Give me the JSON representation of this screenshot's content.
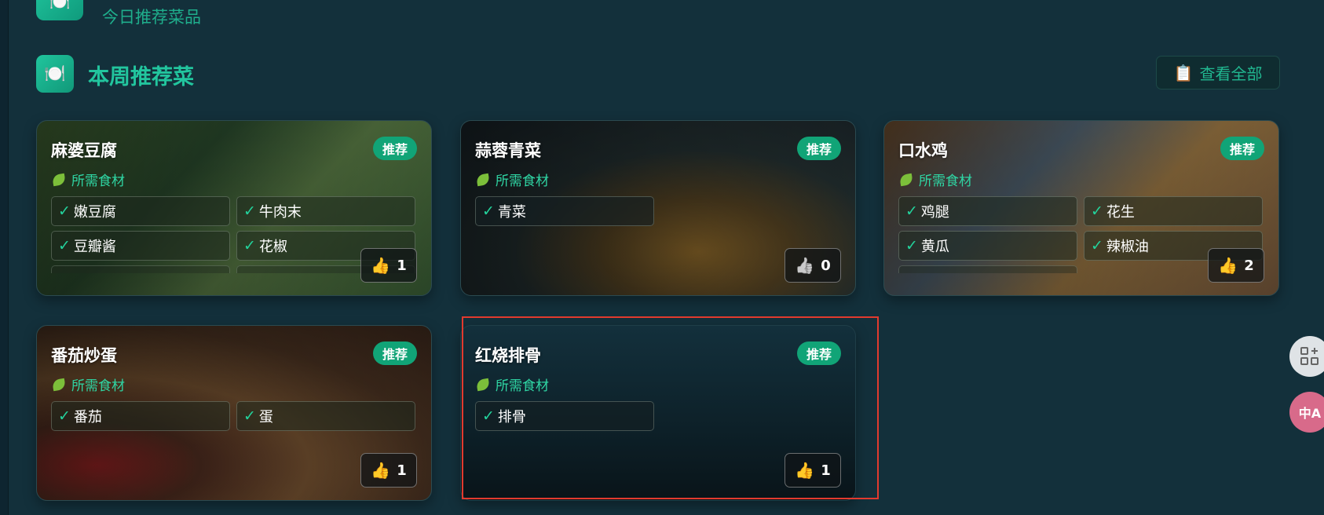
{
  "header": {
    "top_icon": "plate-icon",
    "top_subtitle": "今日推荐菜品",
    "section_icon": "plate-icon",
    "section_title": "本周推荐菜",
    "view_all_icon": "clipboard-icon",
    "view_all_label": "查看全部"
  },
  "badge_label": "推荐",
  "ingredients_label": "所需食材",
  "check_mark": "✓",
  "dishes": [
    {
      "name": "麻婆豆腐",
      "ingredients": [
        "嫩豆腐",
        "牛肉末",
        "豆瓣酱",
        "花椒"
      ],
      "likes": "1",
      "liked": true
    },
    {
      "name": "蒜蓉青菜",
      "ingredients": [
        "青菜"
      ],
      "likes": "0",
      "liked": false
    },
    {
      "name": "口水鸡",
      "ingredients": [
        "鸡腿",
        "花生",
        "黄瓜",
        "辣椒油"
      ],
      "likes": "2",
      "liked": true
    },
    {
      "name": "番茄炒蛋",
      "ingredients": [
        "番茄",
        "蛋"
      ],
      "likes": "1",
      "liked": true
    },
    {
      "name": "红烧排骨",
      "ingredients": [
        "排骨"
      ],
      "likes": "1",
      "liked": true
    }
  ],
  "colors": {
    "background": "#13303b",
    "accent": "#22c59e",
    "badge": "#11a477",
    "highlight_box": "#e23a2e"
  },
  "floating": {
    "apps_icon": "apps-icon",
    "translate_icon": "translate-icon",
    "translate_text": "中A"
  }
}
